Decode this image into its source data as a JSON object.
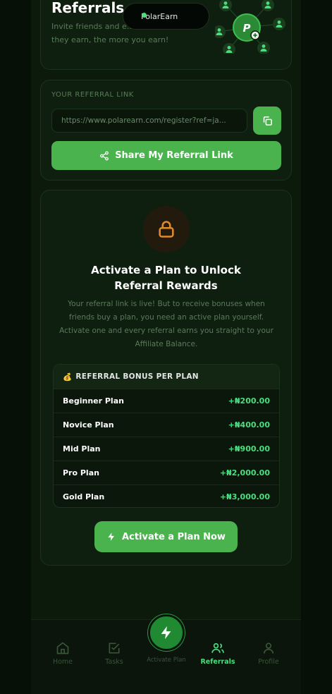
{
  "hero": {
    "title": "Referrals",
    "description": "Invite friends and e... The more they earn, the more you earn!",
    "brand_pill": "PolarEarn",
    "network_center_letter": "P"
  },
  "link_card": {
    "label": "YOUR REFERRAL LINK",
    "url": "https://www.polarearn.com/register?ref=ja...",
    "share_label": "Share My Referral Link"
  },
  "activate_card": {
    "title_line1": "Activate a Plan to Unlock",
    "title_line2": "Referral Rewards",
    "description": "Your referral link is live! But to receive bonuses when friends buy a plan, you need an active plan yourself. Activate one and every referral earns you straight to your Affiliate Balance.",
    "bonus_header": "REFERRAL BONUS PER PLAN",
    "bonus_icon": "money-bag-icon",
    "plans": [
      {
        "name": "Beginner Plan",
        "amount": "+₦200.00"
      },
      {
        "name": "Novice Plan",
        "amount": "+₦400.00"
      },
      {
        "name": "Mid Plan",
        "amount": "+₦900.00"
      },
      {
        "name": "Pro Plan",
        "amount": "+₦2,000.00"
      },
      {
        "name": "Gold Plan",
        "amount": "+₦3,000.00"
      }
    ],
    "activate_label": "Activate a Plan Now"
  },
  "nav": {
    "items": [
      {
        "label": "Home",
        "icon": "home-icon",
        "active": false
      },
      {
        "label": "Tasks",
        "icon": "tasks-icon",
        "active": false
      },
      {
        "label": "Activate Plan",
        "icon": "lightning-icon",
        "active": false
      },
      {
        "label": "Referrals",
        "icon": "users-icon",
        "active": true
      },
      {
        "label": "Profile",
        "icon": "profile-icon",
        "active": false
      }
    ]
  },
  "colors": {
    "accent": "#4ab34e",
    "accent_text": "#4ade80",
    "background": "#0c1a0c",
    "lock": "#e08a2c"
  }
}
